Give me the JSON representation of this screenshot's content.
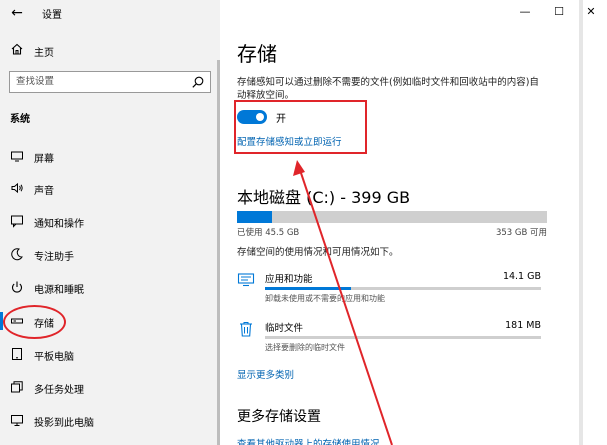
{
  "window": {
    "app_title": "设置",
    "controls": {
      "minimize": "—",
      "maximize": "☐",
      "close": "✕"
    }
  },
  "sidebar": {
    "back_symbol": "←",
    "home_label": "主页",
    "search_placeholder": "查找设置",
    "section_label": "系统",
    "items": [
      {
        "label": "屏幕",
        "icon": "display-icon"
      },
      {
        "label": "声音",
        "icon": "speaker-icon"
      },
      {
        "label": "通知和操作",
        "icon": "notification-icon"
      },
      {
        "label": "专注助手",
        "icon": "moon-icon"
      },
      {
        "label": "电源和睡眠",
        "icon": "power-icon"
      },
      {
        "label": "存储",
        "icon": "storage-icon",
        "active": true
      },
      {
        "label": "平板电脑",
        "icon": "tablet-icon"
      },
      {
        "label": "多任务处理",
        "icon": "multitask-icon"
      },
      {
        "label": "投影到此电脑",
        "icon": "project-icon"
      }
    ]
  },
  "main": {
    "title": "存储",
    "description": "存储感知可以通过删除不需要的文件(例如临时文件和回收站中的内容)自动释放空间。",
    "toggle_label": "开",
    "toggle_on": true,
    "config_link": "配置存储感知或立即运行",
    "disk_title": "本地磁盘 (C:) - 399 GB",
    "disk_used_fraction": 0.114,
    "used_label": "已使用 45.5 GB",
    "total_label": "353 GB 可用",
    "usage_desc": "存储空间的使用情况和可用情况如下。",
    "categories": [
      {
        "name": "应用和功能",
        "size": "14.1 GB",
        "sub": "卸载未使用或不需要的应用和功能",
        "fraction": 0.31,
        "icon": "apps-icon"
      },
      {
        "name": "临时文件",
        "size": "181 MB",
        "sub": "选择要删除的临时文件",
        "fraction": 0.0,
        "icon": "trash-icon"
      }
    ],
    "more_link": "显示更多类别",
    "more_title": "更多存储设置",
    "partial_link": "查看其他驱动器上的存储使用情况"
  },
  "colors": {
    "accent": "#0078d7",
    "annotation": "#e0252a",
    "link": "#0063b1"
  }
}
